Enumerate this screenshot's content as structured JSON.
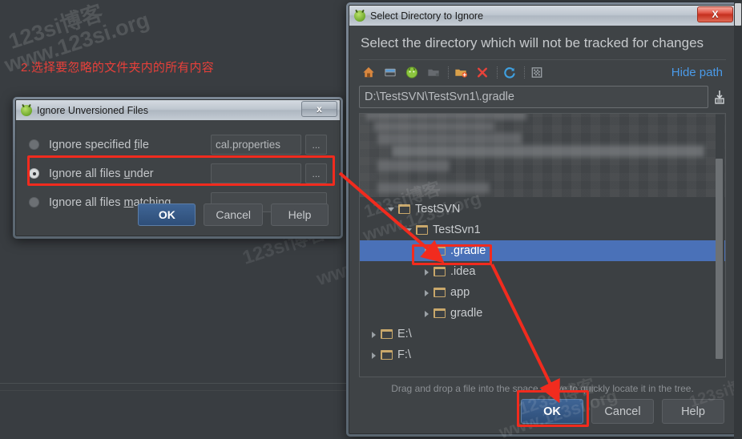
{
  "annotation": {
    "step_text": "2.选择要忽略的文件夹内的所有内容",
    "color": "#e8403a"
  },
  "watermarks": {
    "line1": "123si博客",
    "line2": "www.123si.org",
    "line3": "123si博客",
    "line4": "www.123si.org",
    "line5": "123si博客",
    "line6": "www.123si.org",
    "line7": "123si博客",
    "line8": "www.123si.org",
    "line9": "123si博客"
  },
  "ignore_dialog": {
    "title": "Ignore Unversioned Files",
    "app_icon": "android-studio-icon",
    "close_label": "x",
    "options": [
      {
        "id": "specified-file",
        "label_pre": "Ignore specified ",
        "label_accel": "f",
        "label_post": "ile",
        "selected": false,
        "field_value": "cal.properties",
        "has_field": true,
        "browse_label": "..."
      },
      {
        "id": "all-files-under",
        "label_pre": "Ignore all files ",
        "label_accel": "u",
        "label_post": "nder",
        "selected": true,
        "field_value": "",
        "has_field": true,
        "browse_label": "..."
      },
      {
        "id": "all-files-matching",
        "label_pre": "Ignore all files ",
        "label_accel": "m",
        "label_post": "atching",
        "selected": false,
        "field_value": "",
        "has_field": true,
        "browse_label": ""
      }
    ],
    "buttons": {
      "ok": "OK",
      "cancel": "Cancel",
      "help": "Help"
    }
  },
  "select_dialog": {
    "title": "Select Directory to Ignore",
    "app_icon": "android-studio-icon",
    "close_label": "X",
    "heading": "Select the directory which will not be tracked for changes",
    "toolbar": [
      {
        "name": "home-icon",
        "enabled": true
      },
      {
        "name": "desktop-icon",
        "enabled": true
      },
      {
        "name": "project-icon",
        "enabled": true
      },
      {
        "name": "folder-icon",
        "enabled": false
      },
      {
        "name": "new-folder-icon",
        "enabled": true
      },
      {
        "name": "delete-icon",
        "enabled": true
      },
      {
        "name": "refresh-icon",
        "enabled": true
      },
      {
        "name": "show-hidden-icon",
        "enabled": true
      }
    ],
    "hide_path_label": "Hide path",
    "path_value": "D:\\TestSVN\\TestSvn1\\.gradle",
    "path_drop_icon": "drop-target-icon",
    "tree": [
      {
        "label": "TestSVN",
        "indent": 1,
        "expanded": true,
        "selected": false
      },
      {
        "label": "TestSvn1",
        "indent": 2,
        "expanded": true,
        "selected": false
      },
      {
        "label": ".gradle",
        "indent": 3,
        "expanded": false,
        "selected": true
      },
      {
        "label": ".idea",
        "indent": 3,
        "expanded": false,
        "selected": false
      },
      {
        "label": "app",
        "indent": 3,
        "expanded": false,
        "selected": false
      },
      {
        "label": "gradle",
        "indent": 3,
        "expanded": false,
        "selected": false
      },
      {
        "label": "E:\\",
        "indent": 0,
        "expanded": false,
        "selected": false
      },
      {
        "label": "F:\\",
        "indent": 0,
        "expanded": false,
        "selected": false
      }
    ],
    "tree_hint": "Drag and drop a file into the space above to quickly locate it in the tree.",
    "buttons": {
      "ok": "OK",
      "cancel": "Cancel",
      "help": "Help"
    }
  },
  "highlight_color": "#f12b1e"
}
